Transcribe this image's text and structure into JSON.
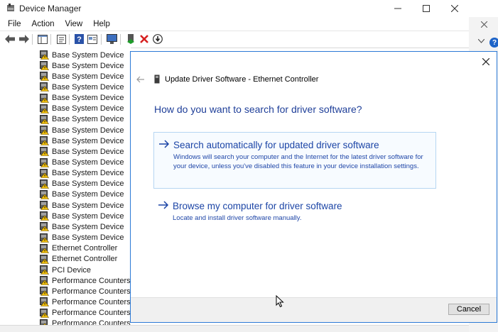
{
  "window": {
    "title": "Device Manager",
    "icon": "device-manager-icon"
  },
  "menu": [
    "File",
    "Action",
    "View",
    "Help"
  ],
  "toolbar": {
    "icons": [
      "back-arrow-icon",
      "forward-arrow-icon",
      "show-hide-tree-icon",
      "properties-icon",
      "help-icon",
      "view-icon",
      "monitor-icon",
      "update-driver-icon",
      "uninstall-icon",
      "download-icon"
    ]
  },
  "tree": {
    "items": [
      "Base System Device",
      "Base System Device",
      "Base System Device",
      "Base System Device",
      "Base System Device",
      "Base System Device",
      "Base System Device",
      "Base System Device",
      "Base System Device",
      "Base System Device",
      "Base System Device",
      "Base System Device",
      "Base System Device",
      "Base System Device",
      "Base System Device",
      "Base System Device",
      "Base System Device",
      "Base System Device",
      "Ethernet Controller",
      "Ethernet Controller",
      "PCI Device",
      "Performance Counters",
      "Performance Counters",
      "Performance Counters",
      "Performance Counters",
      "Performance Counters"
    ]
  },
  "dialog": {
    "title": "Update Driver Software - Ethernet Controller",
    "heading": "How do you want to search for driver software?",
    "option_auto": {
      "title": "Search automatically for updated driver software",
      "description": "Windows will search your computer and the Internet for the latest driver software for your device, unless you've disabled this feature in your device installation settings."
    },
    "option_browse": {
      "title": "Browse my computer for driver software",
      "description": "Locate and install driver software manually."
    },
    "cancel_label": "Cancel"
  },
  "background_window": {
    "help_label": "?"
  },
  "colors": {
    "accent": "#2b79d6",
    "link": "#1c45a6",
    "heading": "#1f3f99"
  }
}
